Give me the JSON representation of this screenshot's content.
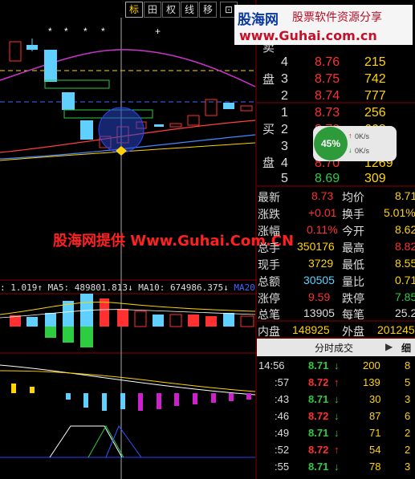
{
  "toolbar": {
    "buttons": [
      "标",
      "田",
      "权",
      "线",
      "移",
      "⊡"
    ]
  },
  "logo": {
    "name": "股海网",
    "slogan": "股票软件资源分享",
    "url": "www.Guhai.com.cn"
  },
  "watermark": "股海网提供 Www.Guhai.Com.CN",
  "indicator_line": {
    "prefix": ": 1.019↑",
    "ma5": "MA5: 489801.813↓",
    "ma10": "MA10: 674986.375↓",
    "ma20": "MA20"
  },
  "orderbook": {
    "sell_label": "卖盘",
    "buy_label": "买盘",
    "sell": [
      {
        "lvl": "4",
        "price": "8.76",
        "vol": "215"
      },
      {
        "lvl": "3",
        "price": "8.75",
        "vol": "742"
      },
      {
        "lvl": "2",
        "price": "8.74",
        "vol": "777"
      }
    ],
    "buy": [
      {
        "lvl": "1",
        "price": "8.73",
        "vol": "256"
      },
      {
        "lvl": "2",
        "price": "8.72",
        "vol": "668"
      },
      {
        "lvl": "3",
        "price": "",
        "vol": ""
      },
      {
        "lvl": "4",
        "price": "8.70",
        "vol": "1269"
      },
      {
        "lvl": "5",
        "price": "8.69",
        "vol": "309"
      }
    ]
  },
  "gauge": {
    "percent": "45%",
    "up": "0K/s",
    "down": "0K/s"
  },
  "stats": [
    {
      "l1": "最新",
      "v1": "8.73",
      "l2": "均价",
      "v2": "8.71",
      "c1": "#ff3030",
      "c2": "#ffd400"
    },
    {
      "l1": "涨跌",
      "v1": "+0.01",
      "l2": "换手",
      "v2": "5.01%",
      "c1": "#ff3030",
      "c2": "#ffd400"
    },
    {
      "l1": "涨幅",
      "v1": "0.11%",
      "l2": "今开",
      "v2": "8.62",
      "c1": "#ff3030",
      "c2": "#ffd400"
    },
    {
      "l1": "总手",
      "v1": "350176",
      "l2": "最高",
      "v2": "8.82",
      "c1": "#ffd400",
      "c2": "#ff3030"
    },
    {
      "l1": "现手",
      "v1": "3729",
      "l2": "最低",
      "v2": "8.55",
      "c1": "#ffd400",
      "c2": "#ffd400"
    },
    {
      "l1": "总额",
      "v1": "30505",
      "l2": "量比",
      "v2": "0.71",
      "c1": "#5fd0ff",
      "c2": "#ffd400"
    },
    {
      "l1": "涨停",
      "v1": "9.59",
      "l2": "跌停",
      "v2": "7.85",
      "c1": "#ff3030",
      "c2": "#2ecc40"
    },
    {
      "l1": "总笔",
      "v1": "13905",
      "l2": "每笔",
      "v2": "25.2",
      "c1": "#ddd",
      "c2": "#ddd"
    },
    {
      "l1": "内盘",
      "v1": "148925",
      "l2": "外盘",
      "v2": "201245",
      "c1": "#ffd400",
      "c2": "#ffd400"
    }
  ],
  "ticks": {
    "header": "分时成交",
    "detail": "细",
    "rows": [
      {
        "t": "14:56",
        "p": "8.71",
        "dir": "↓",
        "v": "200",
        "n": "8",
        "color": "#2ecc40"
      },
      {
        "t": ":57",
        "p": "8.72",
        "dir": "↑",
        "v": "139",
        "n": "5",
        "color": "#ff3030"
      },
      {
        "t": ":43",
        "p": "8.71",
        "dir": "↓",
        "v": "30",
        "n": "3",
        "color": "#2ecc40"
      },
      {
        "t": ":46",
        "p": "8.72",
        "dir": "↓",
        "v": "87",
        "n": "6",
        "color": "#ff3030"
      },
      {
        "t": ":49",
        "p": "8.71",
        "dir": "↓",
        "v": "71",
        "n": "2",
        "color": "#2ecc40"
      },
      {
        "t": ":52",
        "p": "8.72",
        "dir": "↑",
        "v": "54",
        "n": "2",
        "color": "#ff3030"
      },
      {
        "t": ":55",
        "p": "8.71",
        "dir": "↓",
        "v": "78",
        "n": "3",
        "color": "#2ecc40"
      }
    ]
  },
  "colors": {
    "up": "#ff3030",
    "down": "#2ecc40",
    "accent": "#ffd400",
    "grid": "#8b0000"
  }
}
